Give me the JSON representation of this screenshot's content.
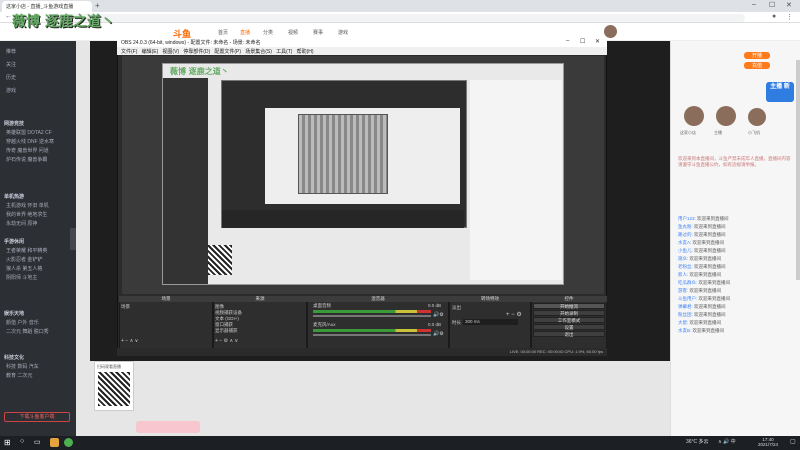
{
  "browser": {
    "tab_title": "这家小店 - 直播_斗鱼游戏直播",
    "url": "douyu.com",
    "new_tab": "+",
    "win_min": "–",
    "win_max": "☐",
    "win_close": "✕"
  },
  "watermark": "薇博 逐鹿之道丶",
  "watermark_small": "薇博 逐鹿之道丶",
  "site": {
    "logo": "斗鱼",
    "nav": [
      "首页",
      "直播",
      "分类",
      "视频",
      "赛事",
      "游戏"
    ],
    "open_live": "开播",
    "recharge": "充值"
  },
  "sidebar": {
    "items": [
      "推荐",
      "关注",
      "历史",
      "游戏"
    ],
    "sections": [
      {
        "title": "网游竞技",
        "rows": [
          "英雄联盟 DOTA2 CF",
          "穿越火线 DNF 逆水寒",
          "传奇 魔兽世界 问道",
          "炉石传说 魔兽争霸"
        ]
      },
      {
        "title": "单机热游",
        "rows": [
          "主机游戏 怀旧 单机",
          "我的世界 绝地求生",
          "永劫无间 原神"
        ]
      },
      {
        "title": "手游休闲",
        "rows": [
          "王者荣耀 和平精英",
          "火影忍者 金铲铲",
          "狼人杀 第五人格",
          "阴阳师 斗地主"
        ]
      },
      {
        "title": "娱乐天地",
        "rows": [
          "颜值 户外 音乐",
          "二次元 舞蹈 脱口秀"
        ]
      },
      {
        "title": "科技文化",
        "rows": [
          "科技 数码 汽车",
          "教育 二次元"
        ]
      }
    ],
    "bottom_btn": "下载斗鱼客户端"
  },
  "room": {
    "qr_label": "扫码观看直播"
  },
  "obs": {
    "title": "OBS 24.0.3 (64-bit, windows) - 配置文件: 未命名 - 场景: 未命名",
    "menu": [
      "文件(F)",
      "编辑(E)",
      "视图(V)",
      "停靠部件(D)",
      "配置文件(P)",
      "场景集合(S)",
      "工具(T)",
      "帮助(H)"
    ],
    "docks": {
      "scenes": "场景",
      "sources": "来源",
      "mixer": "混音器",
      "transitions": "转场特效",
      "controls": "控件"
    },
    "scene_items": [
      "场景"
    ],
    "source_items": [
      "图像",
      "视频捕获设备",
      "文本 (GDI+)",
      "窗口捕获",
      "显示器捕获"
    ],
    "mixer_tracks": [
      {
        "name": "桌面音频",
        "db": "0.0 dB"
      },
      {
        "name": "麦克风/Aux",
        "db": "0.0 dB"
      }
    ],
    "transition": {
      "name": "淡出",
      "duration_label": "时长",
      "duration": "300 ms"
    },
    "controls": [
      "开始推流",
      "开始录制",
      "工作室模式",
      "设置",
      "退出"
    ],
    "status": "LIVE: 00:00:00   REC: 00:00:00   CPU: 1.9%, 60.00 fps"
  },
  "chat": {
    "anchors": [
      "这家小店",
      "主播",
      "小飞机"
    ],
    "intro": "欢迎来到本直播间，斗鱼严禁未成年人直播，直播间内容请遵守斗鱼直播公约，如有违规请举报。",
    "lines": [
      {
        "name": "用户123:",
        "text": "欢迎来到直播间"
      },
      {
        "name": "鱼丸粉:",
        "text": "欢迎来到直播间"
      },
      {
        "name": "路过的:",
        "text": "欢迎来到直播间"
      },
      {
        "name": "水友A:",
        "text": "欢迎来到直播间"
      },
      {
        "name": "小鱼儿:",
        "text": "欢迎来到直播间"
      },
      {
        "name": "观众:",
        "text": "欢迎来到直播间"
      },
      {
        "name": "老粉丝:",
        "text": "欢迎来到直播间"
      },
      {
        "name": "新人:",
        "text": "欢迎来到直播间"
      },
      {
        "name": "吃瓜群众:",
        "text": "欢迎来到直播间"
      },
      {
        "name": "游客:",
        "text": "欢迎来到直播间"
      },
      {
        "name": "斗鱼用户:",
        "text": "欢迎来到直播间"
      },
      {
        "name": "弹幕君:",
        "text": "欢迎来到直播间"
      },
      {
        "name": "粉丝团:",
        "text": "欢迎来到直播间"
      },
      {
        "name": "大佬:",
        "text": "欢迎来到直播间"
      },
      {
        "name": "水友B:",
        "text": "欢迎来到直播间"
      }
    ],
    "promo": "主播 新"
  },
  "taskbar": {
    "weather": "36°C 多云",
    "tray": "∧ 🔊 中",
    "time": "17:40",
    "date": "2021/7/24"
  },
  "colors": {
    "accent": "#ff7a1a",
    "obs_dark": "#2b2b2b",
    "sidebar": "#2c2f33",
    "watermark": "#66aa66"
  }
}
